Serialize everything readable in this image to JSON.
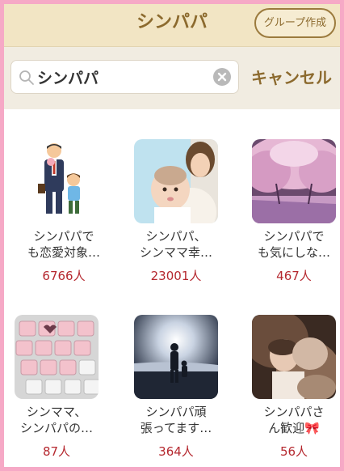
{
  "header": {
    "title": "シンパパ",
    "group_button": "グループ作成"
  },
  "search": {
    "query": "シンパパ",
    "cancel_label": "キャンセル"
  },
  "groups": [
    {
      "title_line1": "シンパパで",
      "title_line2": "も恋愛対象…",
      "count": "6766人"
    },
    {
      "title_line1": "シンパパ、",
      "title_line2": "シンママ幸…",
      "count": "23001人"
    },
    {
      "title_line1": "シンパパで",
      "title_line2": "も気にしな…",
      "count": "467人"
    },
    {
      "title_line1": "シンママ、",
      "title_line2": "シンパパの…",
      "count": "87人"
    },
    {
      "title_line1": "シンパパ頑",
      "title_line2": "張ってます…",
      "count": "364人"
    },
    {
      "title_line1": "シンパパさ",
      "title_line2": "ん歓迎🎀",
      "count": "56人"
    }
  ],
  "colors": {
    "header_bg": "#f2e5c4",
    "brand": "#8c6a2e",
    "count": "#b5282f",
    "frame": "#f6a9c6"
  }
}
